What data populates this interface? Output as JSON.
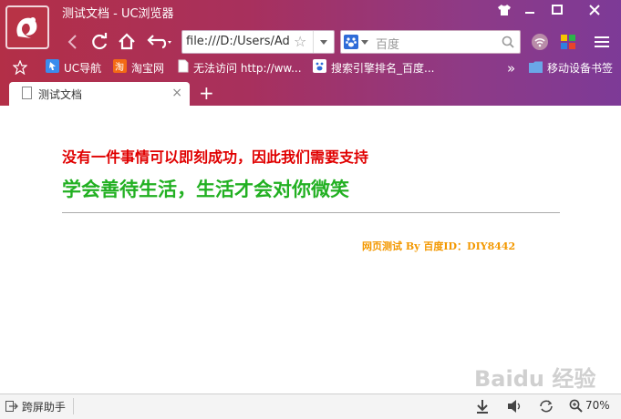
{
  "window": {
    "title": "测试文档 - UC浏览器"
  },
  "toolbar": {
    "url_value": "file:///D:/Users/Ad",
    "search_placeholder": "百度"
  },
  "bookmarks": [
    {
      "label": "UC导航"
    },
    {
      "label": "淘宝网"
    },
    {
      "label": "无法访问 http://ww..."
    },
    {
      "label": "搜索引擎排名_百度..."
    }
  ],
  "bookmarks_more": "»",
  "mobile_bookmarks": "移动设备书签",
  "tab": {
    "label": "测试文档"
  },
  "newtab": "+",
  "page": {
    "line1": "没有一件事情可以即刻成功，因此我们需要支持",
    "line2": "学会善待生活，生活才会对你微笑",
    "signature": "网页测试 By 百度ID：DIY8442"
  },
  "status": {
    "helper": "跨屏助手",
    "zoom": "70%"
  },
  "watermark": "Baidu 经验",
  "colors": {
    "chrome_start": "#b32f47",
    "chrome_end": "#7d3a97",
    "line1": "#e00000",
    "line2": "#22b022",
    "signature": "#f39800"
  }
}
